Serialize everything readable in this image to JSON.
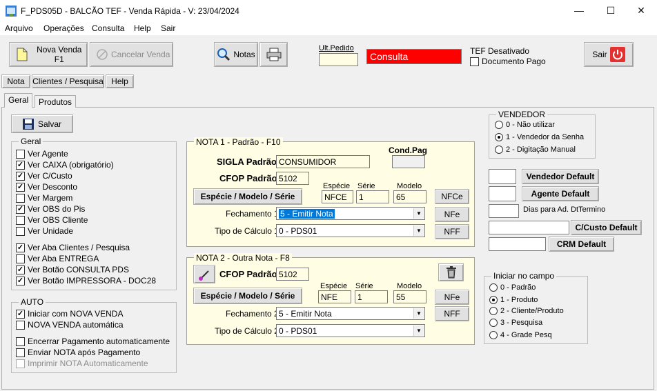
{
  "window": {
    "title": "F_PDS05D - BALCÃO TEF - Venda Rápida - V: 23/04/2024",
    "minimize": "—",
    "maximize": "☐",
    "close": "✕"
  },
  "menu": [
    "Arquivo",
    "Operações",
    "Consulta",
    "Help",
    "Sair"
  ],
  "toolbar": {
    "nova_venda": "Nova Venda F1",
    "cancelar_venda": "Cancelar Venda",
    "notas": "Notas",
    "ult_pedido_label": "Ult.Pedido",
    "ult_pedido_value": "",
    "status": "Consulta",
    "tef_status": "TEF Desativado",
    "documento_pago": "Documento Pago",
    "sair": "Sair"
  },
  "top_tabs": [
    "Nota",
    "Clientes / Pesquisa",
    "Help"
  ],
  "sub_tabs": [
    "Geral",
    "Produtos"
  ],
  "salvar": "Salvar",
  "geral": {
    "title": "Geral",
    "items": [
      {
        "label": "Ver Agente",
        "checked": false
      },
      {
        "label": "Ver CAIXA (obrigatório)",
        "checked": true
      },
      {
        "label": "Ver C/Custo",
        "checked": true
      },
      {
        "label": "Ver Desconto",
        "checked": true
      },
      {
        "label": "Ver Margem",
        "checked": false
      },
      {
        "label": "Ver OBS do Pis",
        "checked": true
      },
      {
        "label": "Ver OBS Cliente",
        "checked": false
      },
      {
        "label": "Ver Unidade",
        "checked": false
      },
      {
        "label": "Ver Aba Clientes / Pesquisa",
        "checked": true
      },
      {
        "label": "Ver Aba ENTREGA",
        "checked": false
      },
      {
        "label": "Ver Botão CONSULTA PDS",
        "checked": true
      },
      {
        "label": "Ver Botão IMPRESSORA - DOC28",
        "checked": true
      }
    ]
  },
  "auto": {
    "title": "AUTO",
    "items": [
      {
        "label": "Iniciar com NOVA VENDA",
        "checked": true,
        "disabled": false
      },
      {
        "label": "NOVA VENDA automática",
        "checked": false,
        "disabled": false
      },
      {
        "label": "Encerrar Pagamento automaticamente",
        "checked": false,
        "disabled": false
      },
      {
        "label": "Enviar NOTA após Pagamento",
        "checked": false,
        "disabled": false
      },
      {
        "label": "Imprimir NOTA Automaticamente",
        "checked": false,
        "disabled": true
      }
    ]
  },
  "nota1": {
    "title": "NOTA 1 - Padrão - F10",
    "sigla_label": "SIGLA Padrão",
    "sigla_value": "CONSUMIDOR",
    "cond_pag_label": "Cond.Pag",
    "cond_pag_value": "",
    "cfop_label": "CFOP Padrão",
    "cfop_value": "5102",
    "especie_btn": "Espécie / Modelo / Série",
    "especie_label": "Espécie",
    "especie_value": "NFCE",
    "serie_label": "Série",
    "serie_value": "1",
    "modelo_label": "Modelo",
    "modelo_value": "65",
    "nfce_btn": "NFCe",
    "nfe_btn": "NFe",
    "nff_btn": "NFF",
    "fechamento_label": "Fechamento 1",
    "fechamento_value": "5 - Emitir Nota",
    "calculo_label": "Tipo de Cálculo 1",
    "calculo_value": "0 - PDS01"
  },
  "nota2": {
    "title": "NOTA 2 - Outra Nota - F8",
    "cfop_label": "CFOP Padrão",
    "cfop_value": "5102",
    "especie_btn": "Espécie / Modelo / Série",
    "especie_label": "Espécie",
    "especie_value": "NFE",
    "serie_label": "Série",
    "serie_value": "1",
    "modelo_label": "Modelo",
    "modelo_value": "55",
    "nfe_btn": "NFe",
    "nff_btn": "NFF",
    "fechamento_label": "Fechamento 2",
    "fechamento_value": "5 - Emitir Nota",
    "calculo_label": "Tipo de Cálculo 2",
    "calculo_value": "0 - PDS01"
  },
  "vendedor": {
    "title": "VENDEDOR",
    "options": [
      {
        "label": "0 - Não utilizar",
        "selected": false
      },
      {
        "label": "1 - Vendedor da Senha",
        "selected": true
      },
      {
        "label": "2 - Digitação Manual",
        "selected": false
      }
    ]
  },
  "defaults": {
    "vendedor_btn": "Vendedor Default",
    "agente_btn": "Agente Default",
    "dias_label": "Dias para Ad. DtTermino",
    "ccusto_btn": "C/Custo Default",
    "crm_btn": "CRM Default"
  },
  "iniciar": {
    "title": "Iniciar no campo",
    "options": [
      {
        "label": "0 - Padrão",
        "selected": false
      },
      {
        "label": "1 - Produto",
        "selected": true
      },
      {
        "label": "2 - Cliente/Produto",
        "selected": false
      },
      {
        "label": "3 - Pesquisa",
        "selected": false
      },
      {
        "label": "4 - Grade Pesq",
        "selected": false
      }
    ]
  },
  "colors": {
    "status_bg": "#ff0000",
    "panel_yellow": "#fffde4",
    "highlight": "#0078d7"
  }
}
